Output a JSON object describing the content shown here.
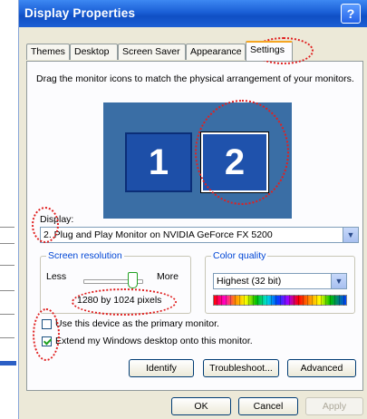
{
  "window": {
    "title": "Display Properties",
    "help_label": "?"
  },
  "tabs": [
    {
      "label": "Themes"
    },
    {
      "label": "Desktop"
    },
    {
      "label": "Screen Saver"
    },
    {
      "label": "Appearance"
    },
    {
      "label": "Settings",
      "active": true
    }
  ],
  "settings": {
    "instruction": "Drag the monitor icons to match the physical arrangement of your monitors.",
    "monitors": [
      {
        "label": "1"
      },
      {
        "label": "2",
        "selected": true
      }
    ],
    "display_label": "Display:",
    "display_value": "2. Plug and Play Monitor on NVIDIA GeForce FX 5200",
    "screen_resolution": {
      "legend": "Screen resolution",
      "less_label": "Less",
      "more_label": "More",
      "value_text": "1280 by 1024 pixels"
    },
    "color_quality": {
      "legend": "Color quality",
      "value": "Highest (32 bit)"
    },
    "checkboxes": [
      {
        "label": "Use this device as the primary monitor.",
        "checked": false
      },
      {
        "label": "Extend my Windows desktop onto this monitor.",
        "checked": true
      }
    ],
    "buttons": {
      "identify": "Identify",
      "troubleshoot": "Troubleshoot...",
      "advanced": "Advanced"
    }
  },
  "dialog_buttons": {
    "ok": "OK",
    "cancel": "Cancel",
    "apply": "Apply"
  },
  "colors": {
    "titlebar": "#1a5fd6",
    "monitor_background": "#3a6ea5",
    "highlight": "#e02020"
  }
}
